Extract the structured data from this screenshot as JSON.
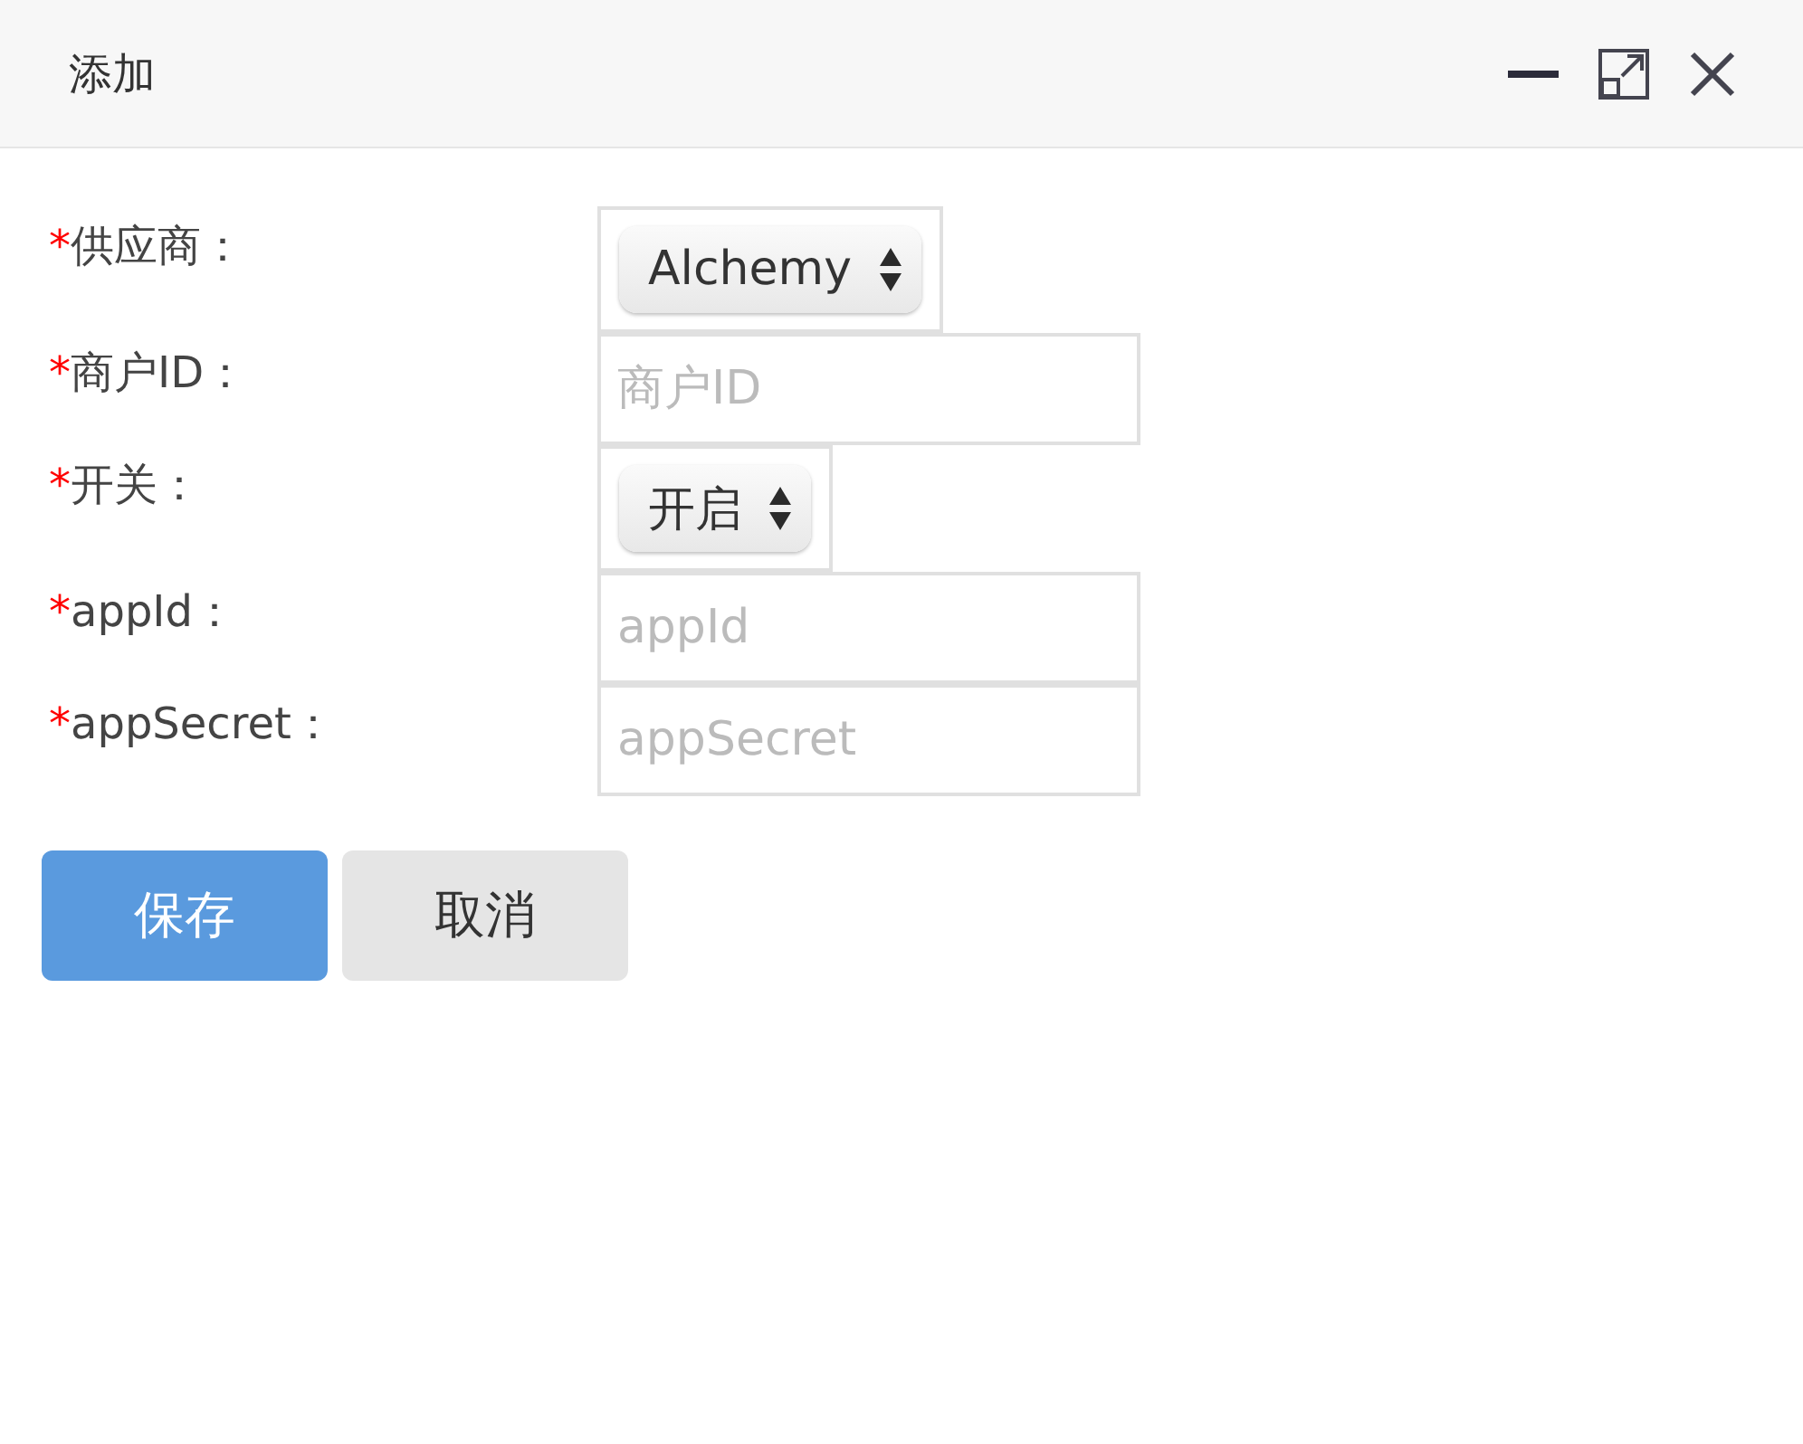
{
  "window": {
    "title": "添加"
  },
  "fields": [
    {
      "kind": "select",
      "mark": "*",
      "label": "供应商：",
      "value": "Alchemy"
    },
    {
      "kind": "text",
      "mark": "*",
      "label": "商户ID：",
      "placeholder": "商户ID"
    },
    {
      "kind": "select",
      "mark": "*",
      "label": "开关：",
      "value": "开启"
    },
    {
      "kind": "text",
      "mark": "*",
      "label": "appId：",
      "placeholder": "appId"
    },
    {
      "kind": "text",
      "mark": "*",
      "label": "appSecret：",
      "placeholder": "appSecret"
    }
  ],
  "buttons": [
    {
      "label": "保存",
      "kind": "primary"
    },
    {
      "label": "取消",
      "kind": "secondary"
    }
  ]
}
